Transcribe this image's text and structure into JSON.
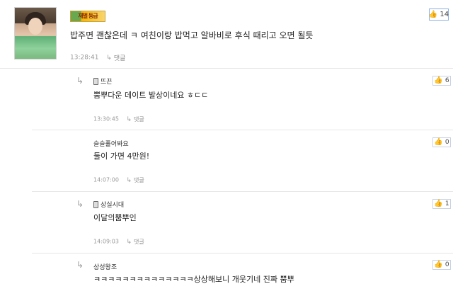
{
  "main_comment": {
    "badge": "재벌 등급",
    "text": "밥주면 괜찮은데 ㅋ 여친이랑 밥먹고 알바비로 후식 때리고 오면 될듯",
    "time": "13:28:41",
    "reply_label": "댓글",
    "likes": "14"
  },
  "replies": [
    {
      "author": "뜨끈",
      "has_phone": true,
      "text": "뿜뿌다운 데이트 발상이네요 ㅎㄷㄷ",
      "time": "13:30:45",
      "reply_label": "댓글",
      "likes": "6"
    },
    {
      "author": "슬슬풀어봐요",
      "has_phone": false,
      "text": "둘이 가면 4만원!",
      "time": "14:07:00",
      "reply_label": "댓글",
      "likes": "0"
    },
    {
      "author": "상실시대",
      "has_phone": true,
      "text": "이달의뿜뿌인",
      "time": "14:09:03",
      "reply_label": "댓글",
      "likes": "1"
    },
    {
      "author": "상성왕조",
      "has_phone": false,
      "text": "ㅋㅋㅋㅋㅋㅋㅋㅋㅋㅋㅋㅋㅋㅋ상상해보니 개웃기네 진짜 뿜뿌",
      "likes": "0"
    }
  ],
  "icons": {
    "like": "thumbs-up-icon",
    "reply_arrow": "reply-arrow-icon",
    "phone": "mobile-phone-icon"
  },
  "colors": {
    "like_border": "#8db0e6",
    "thumb": "#4a7fd8",
    "meta_text": "#999999"
  }
}
